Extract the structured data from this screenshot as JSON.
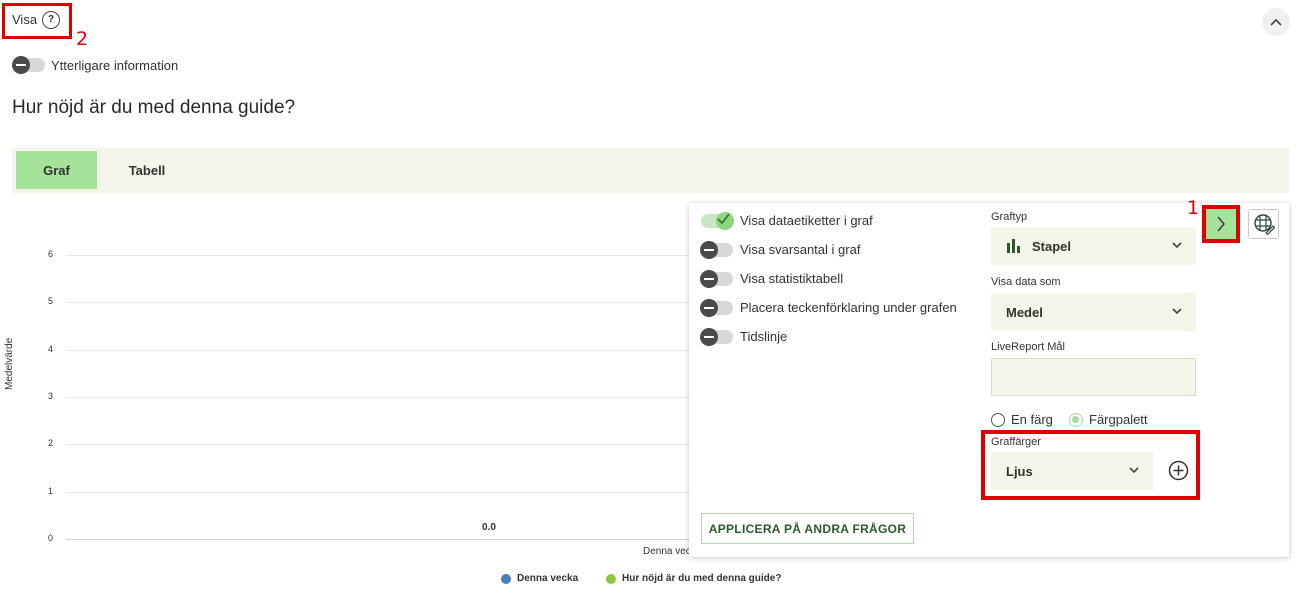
{
  "header": {
    "visa_label": "Visa",
    "help_glyph": "?",
    "annotation_2": "2",
    "annotation_1": "1",
    "extra_info_label": "Ytterligare information",
    "extra_info_on": false
  },
  "page_title": "Hur nöjd är du med denna guide?",
  "tabs": [
    {
      "label": "Graf",
      "active": true
    },
    {
      "label": "Tabell",
      "active": false
    }
  ],
  "chart_data": {
    "type": "bar",
    "ylabel": "Medelvärde",
    "y_ticks": [
      "6",
      "5",
      "4",
      "3",
      "2",
      "1",
      "0"
    ],
    "ylim": [
      0,
      6
    ],
    "categories": [
      "Denna vec"
    ],
    "data_labels": [
      "0.0"
    ],
    "series": [
      {
        "name": "Denna vecka",
        "values": [
          0.0
        ],
        "color": "#4a7fb5"
      },
      {
        "name": "Hur nöjd är du med denna guide?",
        "values": [
          0.0
        ],
        "color": "#8cc63f"
      }
    ],
    "grid": true,
    "legend_position": "bottom"
  },
  "settings": {
    "options": [
      {
        "label": "Visa dataetiketter i graf",
        "on": true
      },
      {
        "label": "Visa svarsantal i graf",
        "on": false
      },
      {
        "label": "Visa statistiktabell",
        "on": false
      },
      {
        "label": "Placera teckenförklaring under grafen",
        "on": false
      },
      {
        "label": "Tidslinje",
        "on": false
      }
    ],
    "graph_type_label": "Graftyp",
    "graph_type_value": "Stapel",
    "show_data_label": "Visa data som",
    "show_data_value": "Medel",
    "livereport_label": "LiveReport Mål",
    "livereport_value": "",
    "radio_one_color": "En färg",
    "radio_palette": "Färgpalett",
    "graph_colors_label": "Graffärger",
    "graph_colors_value": "Ljus",
    "apply_button": "APPLICERA PÅ ANDRA FRÅGOR"
  },
  "icons": [
    "help-icon",
    "chevron-up-icon",
    "chevron-right-icon",
    "table-edit-icon",
    "bar-chart-icon",
    "chevron-down-icon",
    "plus-circle-icon",
    "check-icon"
  ],
  "colors": {
    "accent_green": "#a6e39a",
    "annotation_red": "#e00000",
    "field_bg": "#f3f5e8"
  }
}
